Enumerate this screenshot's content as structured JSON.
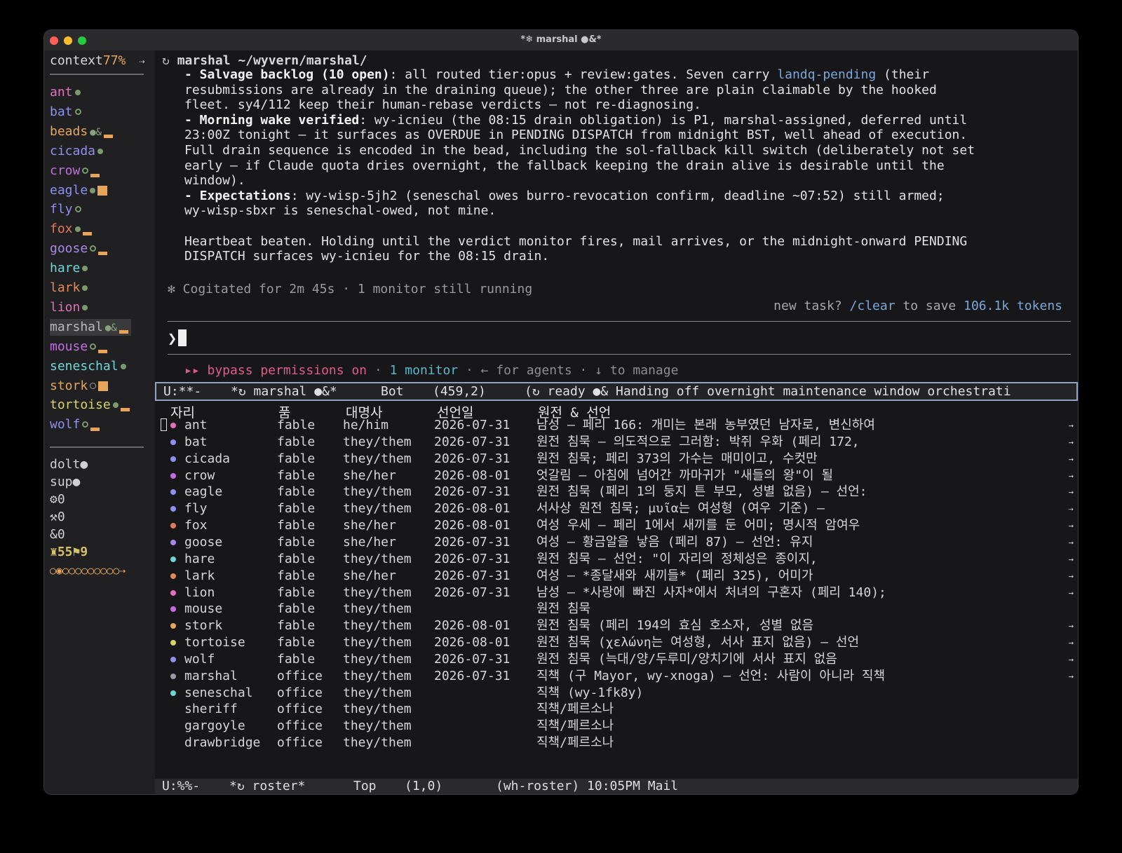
{
  "window": {
    "title": "*❄ marshal ●&*"
  },
  "sidebar": {
    "context_label": "context",
    "context_pct": "77%",
    "context_arrow": "⇢",
    "agents": [
      {
        "name": "ant",
        "color": "#e070b8",
        "ind": "dot"
      },
      {
        "name": "bat",
        "color": "#8f8ff0",
        "ind": "ring"
      },
      {
        "name": "beads",
        "color": "#e6a55b",
        "ind": "busy",
        "mark": "●&"
      },
      {
        "name": "cicada",
        "color": "#8f8ff0",
        "ind": "dot"
      },
      {
        "name": "crow",
        "color": "#c26ee0",
        "ind": "ring-bar"
      },
      {
        "name": "eagle",
        "color": "#8f8ff0",
        "ind": "dot-sq"
      },
      {
        "name": "fly",
        "color": "#8f8ff0",
        "ind": "ring"
      },
      {
        "name": "fox",
        "color": "#e07a5a",
        "ind": "dot-bar"
      },
      {
        "name": "goose",
        "color": "#a888e8",
        "ind": "ring-bar"
      },
      {
        "name": "hare",
        "color": "#6ed6d6",
        "ind": "dot"
      },
      {
        "name": "lark",
        "color": "#e08a5a",
        "ind": "dot"
      },
      {
        "name": "lion",
        "color": "#e070b8",
        "ind": "dot"
      },
      {
        "name": "marshal",
        "color": "#b8b8b8",
        "ind": "busy",
        "mark": "●&",
        "selected": true
      },
      {
        "name": "mouse",
        "color": "#c26ee0",
        "ind": "ring-bar"
      },
      {
        "name": "seneschal",
        "color": "#6ed6d6",
        "ind": "dot"
      },
      {
        "name": "stork",
        "color": "#e6a55b",
        "ind": "open-sq"
      },
      {
        "name": "tortoise",
        "color": "#d4d468",
        "ind": "dot-bar"
      },
      {
        "name": "wolf",
        "color": "#8f8ff0",
        "ind": "ring-bar"
      }
    ],
    "utils": [
      "dolt●",
      "sup●",
      "⚙0",
      "⚒0",
      "&0"
    ],
    "kpi": "♜55⚑9",
    "dots": "○◉○○○○○○○○○⇢"
  },
  "pane": {
    "path_icon": "↻",
    "path_name": "marshal",
    "path_dir": "~/wyvern/marshal/",
    "transcript": [
      {
        "bold": "- Salvage backlog (10 open)",
        "text": ": all routed tier:opus + review:gates. Seven carry ",
        "link": "landq-pending",
        "after": " (their\nresubmissions are already in the draining queue); the other three are plain claimable by the hooked\nfleet. sy4/112 keep their human-rebase verdicts — not re-diagnosing."
      },
      {
        "bold": "- Morning wake verified",
        "text": ": wy-icnieu (the 08:15 drain obligation) is P1, marshal-assigned, deferred until\n23:00Z tonight — it surfaces as OVERDUE in PENDING DISPATCH from midnight BST, well ahead of execution.\nFull drain sequence is encoded in the bead, including the sol-fallback kill switch (deliberately not set\nearly — if Claude quota dries overnight, the fallback keeping the drain alive is desirable until the\nwindow).",
        "link": "",
        "after": ""
      },
      {
        "bold": "- Expectations",
        "text": ": wy-wisp-5jh2 (seneschal owes burro-revocation confirm, deadline ~07:52) still armed;\nwy-wisp-sbxr is seneschal-owed, not mine.",
        "link": "",
        "after": ""
      }
    ],
    "closing": "Heartbeat beaten. Holding until the verdict monitor fires, mail arrives, or the midnight-onward PENDING\nDISPATCH surfaces wy-icnieu for the 08:15 drain.",
    "cogitated": "✻ Cogitated for 2m 45s · 1 monitor still running",
    "newtask_pre": "new task? ",
    "newtask_cmd": "/clear",
    "newtask_mid": " to save ",
    "newtask_tokens": "106.1k tokens",
    "prompt_glyph": "❯",
    "perm_pre": "▸▸ bypass permissions on",
    "perm_sep1": " · ",
    "perm_monitor": "1 monitor",
    "perm_rest": " · ← for agents · ↓ to manage"
  },
  "modeline": {
    "state": "U:**-",
    "buffer": "*↻ marshal ●&*",
    "pos": "Bot",
    "coords": "(459,2)",
    "status": "(↻ ready ●& Handing off overnight maintenance window orchestrati"
  },
  "roster": {
    "headers": [
      "자리",
      "품",
      "대명사",
      "선언일",
      "원전 & 선언"
    ],
    "rows": [
      {
        "dotcolor": "#e070b8",
        "name": "ant",
        "kind": "fable",
        "pron": "he/him",
        "date": "2026-07-31",
        "note": "남성 — 페리 166: 개미는 본래 농부였던 남자로, 변신하여",
        "arrow": "→"
      },
      {
        "dotcolor": "#8f8ff0",
        "name": "bat",
        "kind": "fable",
        "pron": "they/them",
        "date": "2026-07-31",
        "note": "원전 침묵 — 의도적으로 그러함: 박쥐 우화 (페리 172,",
        "arrow": "→"
      },
      {
        "dotcolor": "#8f8ff0",
        "name": "cicada",
        "kind": "fable",
        "pron": "they/them",
        "date": "2026-07-31",
        "note": "원전 침묵; 페리 373의 가수는 매미이고, 수컷만",
        "arrow": "→"
      },
      {
        "dotcolor": "#c26ee0",
        "name": "crow",
        "kind": "fable",
        "pron": "she/her",
        "date": "2026-08-01",
        "note": "엇갈림 — 아침에 넘어간 까마귀가 \"새들의 왕\"이 될",
        "arrow": "→"
      },
      {
        "dotcolor": "#8f8ff0",
        "name": "eagle",
        "kind": "fable",
        "pron": "they/them",
        "date": "2026-07-31",
        "note": "원전 침묵 (페리 1의 둥지 튼 부모, 성별 없음) — 선언:",
        "arrow": "→"
      },
      {
        "dotcolor": "#8f8ff0",
        "name": "fly",
        "kind": "fable",
        "pron": "they/them",
        "date": "2026-08-01",
        "note": "서사상 원전 침묵; μυῖα는 여성형 (여우 기준) —",
        "arrow": "⇢"
      },
      {
        "dotcolor": "#e07a5a",
        "name": "fox",
        "kind": "fable",
        "pron": "she/her",
        "date": "2026-08-01",
        "note": "여성 우세 — 페리 1에서 새끼를 둔 어미; 명시적 암여우",
        "arrow": "→"
      },
      {
        "dotcolor": "#a888e8",
        "name": "goose",
        "kind": "fable",
        "pron": "she/her",
        "date": "2026-07-31",
        "note": "여성 — 황금알을 낳음 (페리 87) — 선언: 유지",
        "arrow": "→"
      },
      {
        "dotcolor": "#6ed6d6",
        "name": "hare",
        "kind": "fable",
        "pron": "they/them",
        "date": "2026-07-31",
        "note": "원전 침묵 — 선언: \"이 자리의 정체성은 종이지,",
        "arrow": "→"
      },
      {
        "dotcolor": "#e08a5a",
        "name": "lark",
        "kind": "fable",
        "pron": "she/her",
        "date": "2026-07-31",
        "note": "여성 — *종달새와 새끼들* (페리 325), 어미가",
        "arrow": "→"
      },
      {
        "dotcolor": "#e070b8",
        "name": "lion",
        "kind": "fable",
        "pron": "they/them",
        "date": "2026-07-31",
        "note": "남성 — *사랑에 빠진 사자*에서 처녀의 구혼자 (페리 140);",
        "arrow": "→"
      },
      {
        "dotcolor": "#c26ee0",
        "name": "mouse",
        "kind": "fable",
        "pron": "they/them",
        "date": "",
        "note": "원전 침묵",
        "arrow": ""
      },
      {
        "dotcolor": "#e6a55b",
        "name": "stork",
        "kind": "fable",
        "pron": "they/them",
        "date": "2026-08-01",
        "note": "원전 침묵 (페리 194의 효심 호소자, 성별 없음",
        "arrow": "→"
      },
      {
        "dotcolor": "#d4d468",
        "name": "tortoise",
        "kind": "fable",
        "pron": "they/them",
        "date": "2026-08-01",
        "note": "원전 침묵 (χελώνη는 여성형, 서사 표지 없음) — 선언",
        "arrow": "→"
      },
      {
        "dotcolor": "#8f8ff0",
        "name": "wolf",
        "kind": "fable",
        "pron": "they/them",
        "date": "2026-07-31",
        "note": "원전 침묵 (늑대/양/두루미/양치기에 서사 표지 없음",
        "arrow": "→"
      },
      {
        "dotcolor": "#9a9aa6",
        "name": "marshal",
        "kind": "office",
        "pron": "they/them",
        "date": "2026-07-31",
        "note": "직책 (구 Mayor, wy-xnoga) — 선언: 사람이 아니라 직책",
        "arrow": "→"
      },
      {
        "dotcolor": "#6ed6d6",
        "name": "seneschal",
        "kind": "office",
        "pron": "they/them",
        "date": "",
        "note": "직책 (wy-1fk8y)",
        "arrow": ""
      },
      {
        "dotcolor": "",
        "name": "sheriff",
        "kind": "office",
        "pron": "they/them",
        "date": "",
        "note": "직책/페르소나",
        "arrow": ""
      },
      {
        "dotcolor": "",
        "name": "gargoyle",
        "kind": "office",
        "pron": "they/them",
        "date": "",
        "note": "직책/페르소나",
        "arrow": ""
      },
      {
        "dotcolor": "",
        "name": "drawbridge",
        "kind": "office",
        "pron": "they/them",
        "date": "",
        "note": "직책/페르소나",
        "arrow": ""
      }
    ]
  },
  "bottombar": {
    "state": "U:%%-",
    "buffer": "*↻ roster*",
    "pos": "Top",
    "coords": "(1,0)",
    "mode": "(wh-roster) 10:05PM Mail"
  }
}
